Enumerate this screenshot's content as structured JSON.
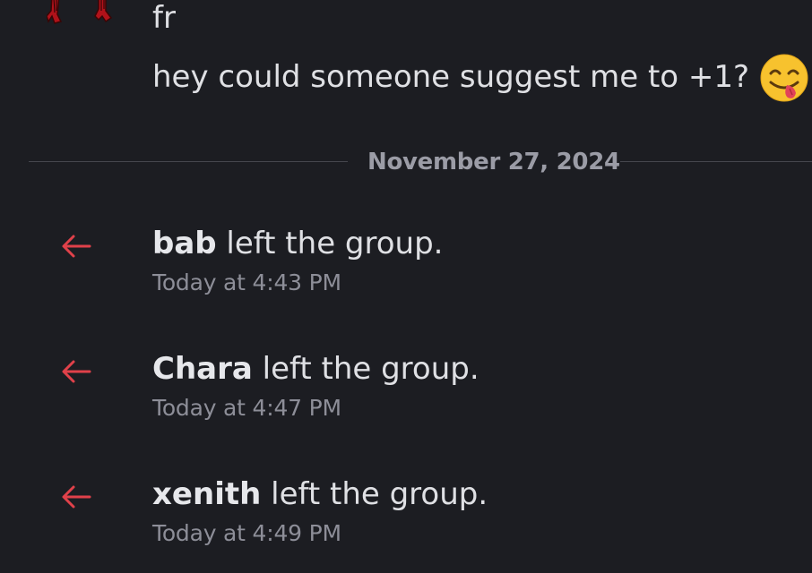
{
  "messages": [
    {
      "text": "fr"
    },
    {
      "text": "hey could someone suggest me to +1?",
      "emoji": "face-savoring-food-icon"
    }
  ],
  "date_divider": {
    "label": "November 27, 2024"
  },
  "events": [
    {
      "user": "bab",
      "action": " left the group.",
      "time": "Today at 4:43 PM",
      "icon": "leave-arrow-icon"
    },
    {
      "user": "Chara",
      "action": " left the group.",
      "time": "Today at 4:47 PM",
      "icon": "leave-arrow-icon"
    },
    {
      "user": "xenith",
      "action": " left the group.",
      "time": "Today at 4:49 PM",
      "icon": "leave-arrow-icon"
    }
  ],
  "colors": {
    "background": "#1c1d22",
    "text": "#dfe0e4",
    "muted": "#8d8e98",
    "leave_arrow": "#e0414a",
    "divider": "#45464d"
  }
}
